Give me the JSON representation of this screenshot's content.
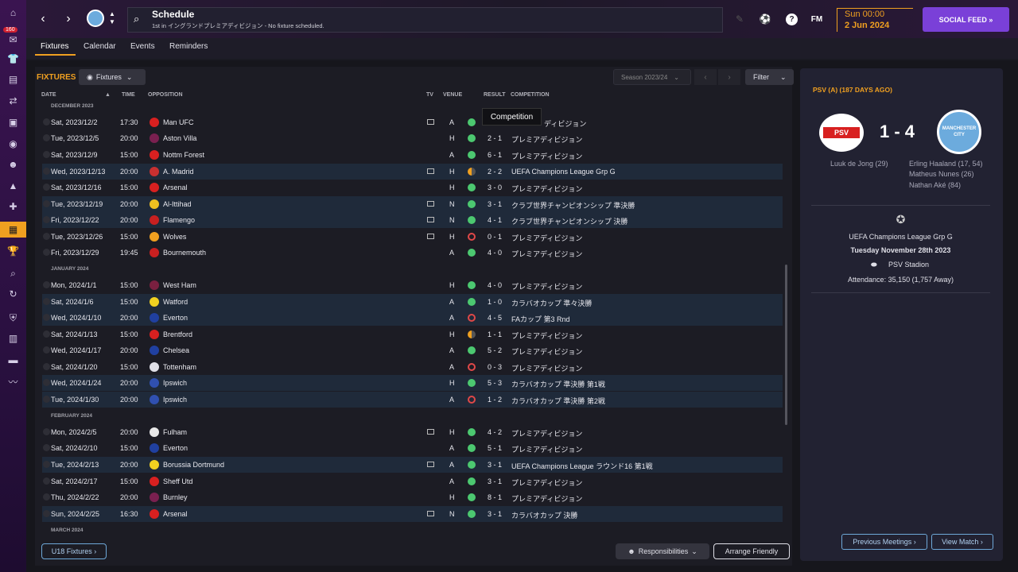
{
  "header": {
    "title": "Schedule",
    "subtitle": "1st in イングランドプレミアディビジョン - No fixture scheduled.",
    "brand": "FM",
    "day_time": "Sun 00:00",
    "date": "2 Jun 2024",
    "social_feed": "SOCIAL FEED »",
    "sidebar_badge": "160"
  },
  "tabs": [
    "Fixtures",
    "Calendar",
    "Events",
    "Reminders"
  ],
  "fixtures": {
    "title": "FIXTURES",
    "dropdown": "Fixtures",
    "season": "Season 2023/24",
    "filter": "Filter",
    "columns": {
      "date": "DATE",
      "time": "TIME",
      "opposition": "OPPOSITION",
      "tv": "TV",
      "venue": "VENUE",
      "result": "RESULT",
      "competition": "COMPETITION"
    },
    "tooltip": "Competition",
    "months": [
      "DECEMBER 2023",
      "JANUARY 2024",
      "FEBRUARY 2024",
      "MARCH 2024"
    ],
    "rows": [
      {
        "date": "Sat, 2023/12/2",
        "time": "17:30",
        "opp": "Man UFC",
        "venue": "A",
        "score": "",
        "comp": "プレミアディビジョン",
        "res": "w",
        "tv": true,
        "crest": "#d82020"
      },
      {
        "date": "Tue, 2023/12/5",
        "time": "20:00",
        "opp": "Aston Villa",
        "venue": "H",
        "score": "2 - 1",
        "comp": "プレミアディビジョン",
        "res": "w",
        "tv": false,
        "crest": "#7a2050"
      },
      {
        "date": "Sat, 2023/12/9",
        "time": "15:00",
        "opp": "Nottm Forest",
        "venue": "A",
        "score": "6 - 1",
        "comp": "プレミアディビジョン",
        "res": "w",
        "tv": false,
        "crest": "#d82020"
      },
      {
        "date": "Wed, 2023/12/13",
        "time": "20:00",
        "opp": "A. Madrid",
        "venue": "H",
        "score": "2 - 2",
        "comp": "UEFA Champions League Grp G",
        "res": "d",
        "tv": true,
        "crest": "#c83030"
      },
      {
        "date": "Sat, 2023/12/16",
        "time": "15:00",
        "opp": "Arsenal",
        "venue": "H",
        "score": "3 - 0",
        "comp": "プレミアディビジョン",
        "res": "w",
        "tv": false,
        "crest": "#d82020"
      },
      {
        "date": "Tue, 2023/12/19",
        "time": "20:00",
        "opp": "Al-Ittihad",
        "venue": "N",
        "score": "3 - 1",
        "comp": "クラブ世界チャンピオンシップ 準決勝",
        "res": "w",
        "tv": true,
        "crest": "#f0c020"
      },
      {
        "date": "Fri, 2023/12/22",
        "time": "20:00",
        "opp": "Flamengo",
        "venue": "N",
        "score": "4 - 1",
        "comp": "クラブ世界チャンピオンシップ 決勝",
        "res": "w",
        "tv": true,
        "crest": "#c82020"
      },
      {
        "date": "Tue, 2023/12/26",
        "time": "15:00",
        "opp": "Wolves",
        "venue": "H",
        "score": "0 - 1",
        "comp": "プレミアディビジョン",
        "res": "l",
        "tv": true,
        "crest": "#f0a020"
      },
      {
        "date": "Fri, 2023/12/29",
        "time": "19:45",
        "opp": "Bournemouth",
        "venue": "A",
        "score": "4 - 0",
        "comp": "プレミアディビジョン",
        "res": "w",
        "tv": false,
        "crest": "#c82020"
      },
      {
        "date": "Mon, 2024/1/1",
        "time": "15:00",
        "opp": "West Ham",
        "venue": "H",
        "score": "4 - 0",
        "comp": "プレミアディビジョン",
        "res": "w",
        "tv": false,
        "crest": "#7a2040"
      },
      {
        "date": "Sat, 2024/1/6",
        "time": "15:00",
        "opp": "Watford",
        "venue": "A",
        "score": "1 - 0",
        "comp": "カラバオカップ 準々決勝",
        "res": "w",
        "tv": false,
        "crest": "#f0d020"
      },
      {
        "date": "Wed, 2024/1/10",
        "time": "20:00",
        "opp": "Everton",
        "venue": "A",
        "score": "4 - 5",
        "comp": "FAカップ 第3 Rnd",
        "res": "l",
        "tv": false,
        "crest": "#2040a0"
      },
      {
        "date": "Sat, 2024/1/13",
        "time": "15:00",
        "opp": "Brentford",
        "venue": "H",
        "score": "1 - 1",
        "comp": "プレミアディビジョン",
        "res": "d",
        "tv": false,
        "crest": "#d82020"
      },
      {
        "date": "Wed, 2024/1/17",
        "time": "20:00",
        "opp": "Chelsea",
        "venue": "A",
        "score": "5 - 2",
        "comp": "プレミアディビジョン",
        "res": "w",
        "tv": false,
        "crest": "#2040a0"
      },
      {
        "date": "Sat, 2024/1/20",
        "time": "15:00",
        "opp": "Tottenham",
        "venue": "A",
        "score": "0 - 3",
        "comp": "プレミアディビジョン",
        "res": "l",
        "tv": false,
        "crest": "#e0e0e8"
      },
      {
        "date": "Wed, 2024/1/24",
        "time": "20:00",
        "opp": "Ipswich",
        "venue": "H",
        "score": "5 - 3",
        "comp": "カラバオカップ 準決勝 第1戦",
        "res": "w",
        "tv": false,
        "crest": "#3050b0"
      },
      {
        "date": "Tue, 2024/1/30",
        "time": "20:00",
        "opp": "Ipswich",
        "venue": "A",
        "score": "1 - 2",
        "comp": "カラバオカップ 準決勝 第2戦",
        "res": "l",
        "tv": false,
        "crest": "#3050b0"
      },
      {
        "date": "Mon, 2024/2/5",
        "time": "20:00",
        "opp": "Fulham",
        "venue": "H",
        "score": "4 - 2",
        "comp": "プレミアディビジョン",
        "res": "w",
        "tv": true,
        "crest": "#e8e8e8"
      },
      {
        "date": "Sat, 2024/2/10",
        "time": "15:00",
        "opp": "Everton",
        "venue": "A",
        "score": "5 - 1",
        "comp": "プレミアディビジョン",
        "res": "w",
        "tv": false,
        "crest": "#2040a0"
      },
      {
        "date": "Tue, 2024/2/13",
        "time": "20:00",
        "opp": "Borussia Dortmund",
        "venue": "A",
        "score": "3 - 1",
        "comp": "UEFA Champions League ラウンド16 第1戦",
        "res": "w",
        "tv": true,
        "crest": "#f0d020"
      },
      {
        "date": "Sat, 2024/2/17",
        "time": "15:00",
        "opp": "Sheff Utd",
        "venue": "A",
        "score": "3 - 1",
        "comp": "プレミアディビジョン",
        "res": "w",
        "tv": false,
        "crest": "#d82020"
      },
      {
        "date": "Thu, 2024/2/22",
        "time": "20:00",
        "opp": "Burnley",
        "venue": "H",
        "score": "8 - 1",
        "comp": "プレミアディビジョン",
        "res": "w",
        "tv": false,
        "crest": "#7a2050"
      },
      {
        "date": "Sun, 2024/2/25",
        "time": "16:30",
        "opp": "Arsenal",
        "venue": "N",
        "score": "3 - 1",
        "comp": "カラバオカップ 決勝",
        "res": "w",
        "tv": true,
        "crest": "#d82020"
      }
    ],
    "u18_button": "U18 Fixtures ›",
    "responsibilities": "Responsibilities",
    "arrange_friendly": "Arrange Friendly"
  },
  "match": {
    "title": "PSV (A) (187 DAYS AGO)",
    "home_badge_text": "PSV",
    "away_badge_text": "MANCHESTER CITY",
    "score": "1 - 4",
    "home_scorers": [
      "Luuk de Jong (29)"
    ],
    "away_scorers": [
      "Erling Haaland (17, 54)",
      "Matheus Nunes (26)",
      "Nathan Aké (84)"
    ],
    "competition": "UEFA Champions League Grp G",
    "date": "Tuesday November 28th 2023",
    "stadium": "PSV Stadion",
    "attendance": "Attendance: 35,150 (1,757 Away)",
    "prev_button": "Previous Meetings ›",
    "view_button": "View Match ›"
  }
}
